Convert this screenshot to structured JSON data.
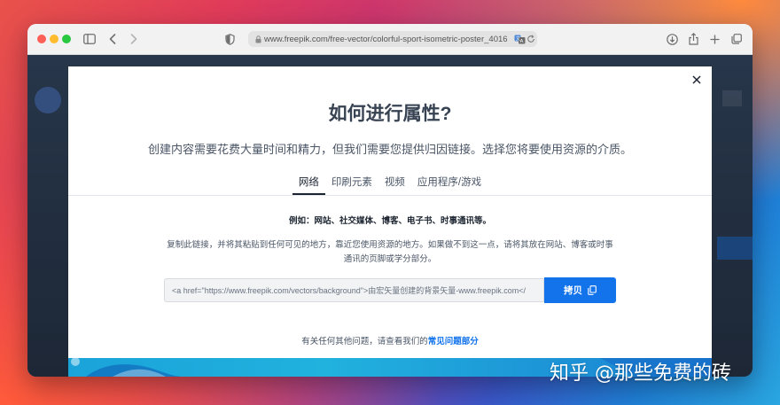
{
  "browser": {
    "url": "www.freepik.com/free-vector/colorful-sport-isometric-poster_4016",
    "icons": {
      "sidebar": "sidebar-icon",
      "back": "back-icon",
      "forward": "forward-icon",
      "shield": "privacy-shield-icon",
      "lock": "lock-icon",
      "translate": "translate-icon",
      "reload": "reload-icon",
      "downloads": "download-icon",
      "share": "share-icon",
      "new_tab": "plus-icon",
      "tabs": "tab-overview-icon"
    }
  },
  "modal": {
    "title": "如何进行属性?",
    "subtitle": "创建内容需要花费大量时间和精力，但我们需要您提供归因链接。选择您将要使用资源的介质。",
    "tabs": [
      {
        "label": "网络",
        "active": true
      },
      {
        "label": "印刷元素",
        "active": false
      },
      {
        "label": "视频",
        "active": false
      },
      {
        "label": "应用程序/游戏",
        "active": false
      }
    ],
    "example": "例如：网站、社交媒体、博客、电子书、时事通讯等。",
    "instructions": "复制此链接，并将其粘贴到任何可见的地方，靠近您使用资源的地方。如果做不到这一点，请将其放在网站、博客或时事通讯的页脚或学分部分。",
    "attribution_code": "<a href=\"https://www.freepik.com/vectors/background\">由宏矢量创建的背景矢量-www.freepik.com</",
    "copy_label": "拷贝",
    "faq_prefix": "有关任何其他问题，请查看我们的",
    "faq_link": "常见问题部分",
    "accent_color": "#1273eb"
  },
  "watermark": "知乎 @那些免费的砖"
}
